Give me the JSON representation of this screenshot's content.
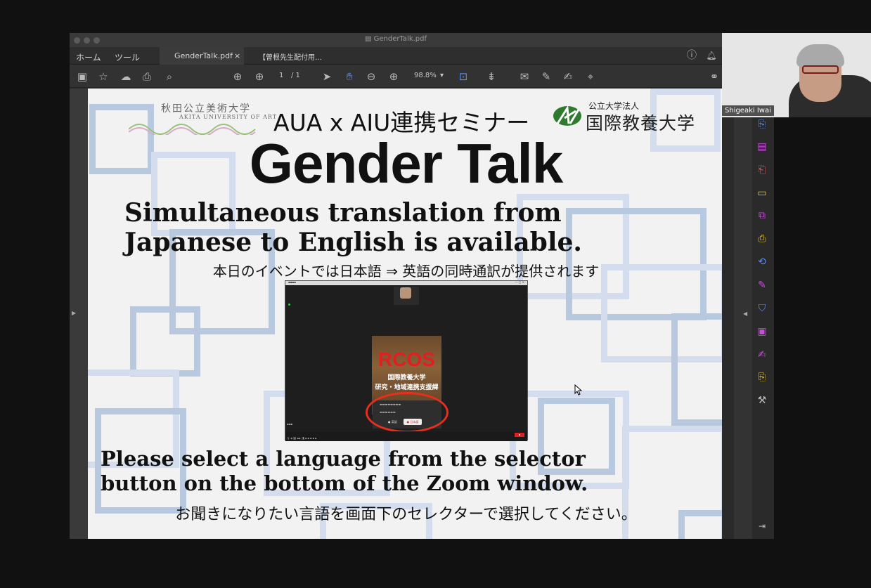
{
  "window": {
    "title": "GenderTalk.pdf"
  },
  "tabs": {
    "home": "ホーム",
    "tools": "ツール",
    "doc1": "GenderTalk.pdf",
    "doc1_close": "×",
    "doc2": "【曽根先生配付用…"
  },
  "toolbar": {
    "page_current": "1",
    "page_total": "/ 1",
    "zoom": "98.8%"
  },
  "slide": {
    "logo_left_jp": "秋田公立美術大学",
    "logo_left_en": "AKITA UNIVERSITY OF ART",
    "seminar_title": "AUA x AIU連携セミナー",
    "logo_right_small": "公立大学法人",
    "logo_right_big": "国際教養大学",
    "main_title": "Gender Talk",
    "headline_line1": "Simultaneous translation from",
    "headline_line2": "Japanese to English is available.",
    "subtitle_jp": "本日のイベントでは日本語 ⇒ 英語の同時通訳が提供されます",
    "bottom_line1": "Please select a language from the selector",
    "bottom_line2": "button on the bottom of the Zoom window.",
    "bottom_jp": "お聞きになりたい言語を画面下のセレクターで選択してください。"
  },
  "zoom_screenshot": {
    "rcos": "RCOS",
    "rcos_jp1": "国際教養大学",
    "rcos_jp2": "研究・地域連携支援課",
    "lang_off": "● 英語",
    "lang_jp": "● 日本語"
  },
  "webcam": {
    "participant_name": "Shigeaki Iwai"
  },
  "colors": {
    "accent_magenta": "#c74fd9",
    "accent_yellow": "#e8c52a",
    "accent_blue": "#5b8ff0",
    "red_circle": "#e82e1e"
  }
}
